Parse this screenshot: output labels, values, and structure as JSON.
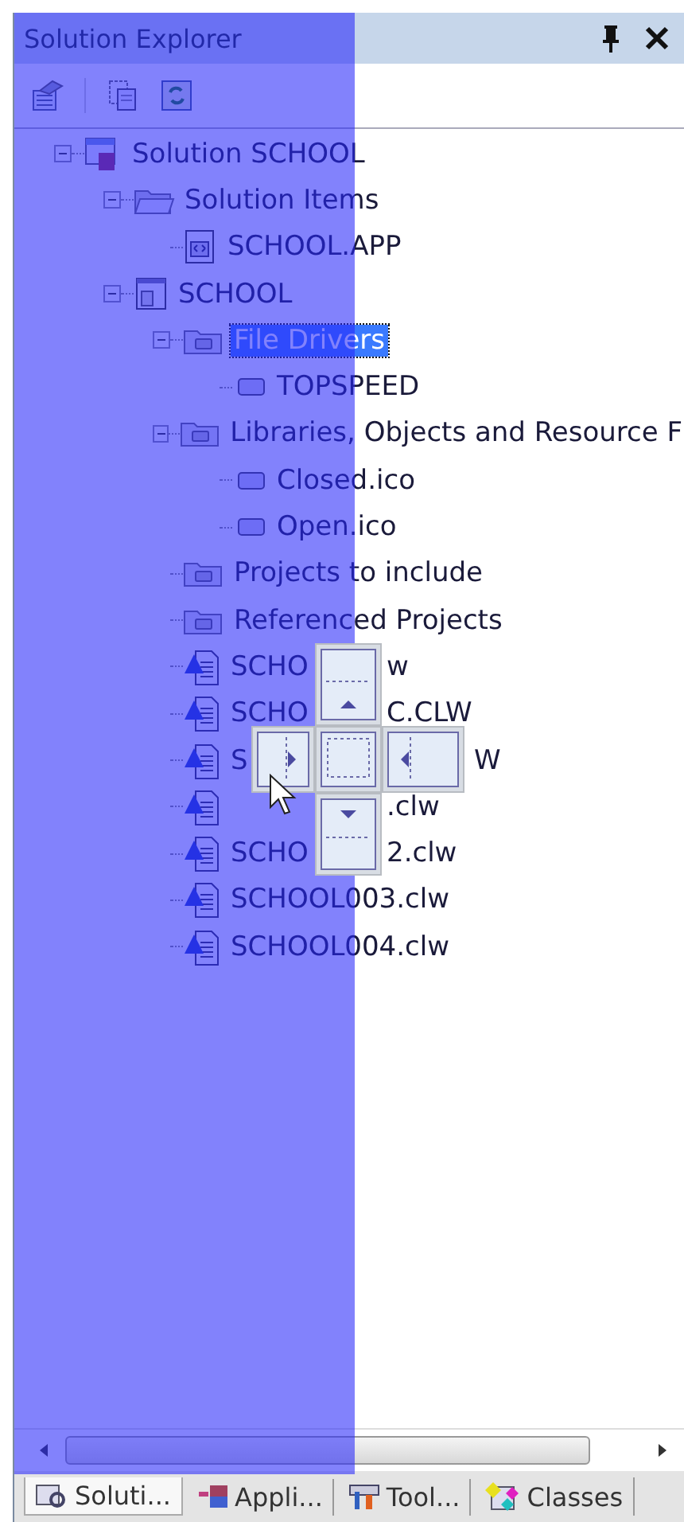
{
  "window": {
    "title": "Solution Explorer"
  },
  "tree": [
    {
      "label": "Solution SCHOOL",
      "kind": "solution",
      "expanded": true,
      "selected": false,
      "children": [
        {
          "label": "Solution Items",
          "kind": "folder",
          "expanded": true,
          "selected": false,
          "children": [
            {
              "label": "SCHOOL.APP",
              "kind": "app",
              "selected": false
            }
          ]
        },
        {
          "label": "SCHOOL",
          "kind": "project",
          "expanded": true,
          "selected": false,
          "children": [
            {
              "label": "File Drivers",
              "kind": "folder-special",
              "expanded": true,
              "selected": true,
              "children": [
                {
                  "label": "TOPSPEED",
                  "kind": "item",
                  "selected": false
                }
              ]
            },
            {
              "label": "Libraries, Objects and Resource F",
              "kind": "folder-special",
              "expanded": true,
              "selected": false,
              "children": [
                {
                  "label": "Closed.ico",
                  "kind": "item",
                  "selected": false
                },
                {
                  "label": "Open.ico",
                  "kind": "item",
                  "selected": false
                }
              ]
            },
            {
              "label": "Projects to include",
              "kind": "folder-closed",
              "selected": false
            },
            {
              "label": "Referenced Projects",
              "kind": "folder-closed",
              "selected": false
            },
            {
              "label": "SCHO",
              "tail": "w",
              "kind": "source",
              "selected": false
            },
            {
              "label": "SCHO",
              "tail": "C.CLW",
              "kind": "source",
              "selected": false
            },
            {
              "label": "S",
              "tail": "W",
              "kind": "source",
              "selected": false
            },
            {
              "tail": ".clw",
              "kind": "source"
            },
            {
              "label": "SCHO",
              "tail": "2.clw",
              "kind": "source",
              "selected": false
            },
            {
              "label": "SCHOOL003.clw",
              "kind": "source",
              "selected": false
            },
            {
              "label": "SCHOOL004.clw",
              "kind": "source",
              "selected": false
            }
          ]
        }
      ]
    }
  ],
  "tabs": [
    {
      "label": "Soluti...",
      "kind": "solution",
      "selected": true
    },
    {
      "label": "Appli...",
      "kind": "app",
      "selected": false
    },
    {
      "label": "Tool...",
      "kind": "toolbox",
      "selected": false
    },
    {
      "label": "Classes",
      "kind": "classes",
      "selected": false
    }
  ]
}
